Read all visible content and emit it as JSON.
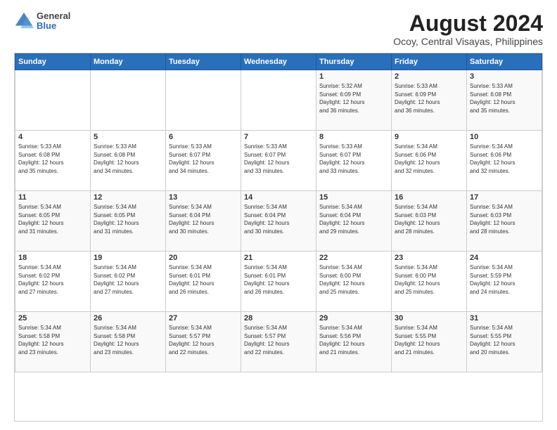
{
  "header": {
    "logo_line1": "General",
    "logo_line2": "Blue",
    "title": "August 2024",
    "subtitle": "Ocoy, Central Visayas, Philippines"
  },
  "weekdays": [
    "Sunday",
    "Monday",
    "Tuesday",
    "Wednesday",
    "Thursday",
    "Friday",
    "Saturday"
  ],
  "weeks": [
    [
      {
        "day": "",
        "info": ""
      },
      {
        "day": "",
        "info": ""
      },
      {
        "day": "",
        "info": ""
      },
      {
        "day": "",
        "info": ""
      },
      {
        "day": "1",
        "info": "Sunrise: 5:32 AM\nSunset: 6:09 PM\nDaylight: 12 hours\nand 36 minutes."
      },
      {
        "day": "2",
        "info": "Sunrise: 5:33 AM\nSunset: 6:09 PM\nDaylight: 12 hours\nand 36 minutes."
      },
      {
        "day": "3",
        "info": "Sunrise: 5:33 AM\nSunset: 6:08 PM\nDaylight: 12 hours\nand 35 minutes."
      }
    ],
    [
      {
        "day": "4",
        "info": "Sunrise: 5:33 AM\nSunset: 6:08 PM\nDaylight: 12 hours\nand 35 minutes."
      },
      {
        "day": "5",
        "info": "Sunrise: 5:33 AM\nSunset: 6:08 PM\nDaylight: 12 hours\nand 34 minutes."
      },
      {
        "day": "6",
        "info": "Sunrise: 5:33 AM\nSunset: 6:07 PM\nDaylight: 12 hours\nand 34 minutes."
      },
      {
        "day": "7",
        "info": "Sunrise: 5:33 AM\nSunset: 6:07 PM\nDaylight: 12 hours\nand 33 minutes."
      },
      {
        "day": "8",
        "info": "Sunrise: 5:33 AM\nSunset: 6:07 PM\nDaylight: 12 hours\nand 33 minutes."
      },
      {
        "day": "9",
        "info": "Sunrise: 5:34 AM\nSunset: 6:06 PM\nDaylight: 12 hours\nand 32 minutes."
      },
      {
        "day": "10",
        "info": "Sunrise: 5:34 AM\nSunset: 6:06 PM\nDaylight: 12 hours\nand 32 minutes."
      }
    ],
    [
      {
        "day": "11",
        "info": "Sunrise: 5:34 AM\nSunset: 6:05 PM\nDaylight: 12 hours\nand 31 minutes."
      },
      {
        "day": "12",
        "info": "Sunrise: 5:34 AM\nSunset: 6:05 PM\nDaylight: 12 hours\nand 31 minutes."
      },
      {
        "day": "13",
        "info": "Sunrise: 5:34 AM\nSunset: 6:04 PM\nDaylight: 12 hours\nand 30 minutes."
      },
      {
        "day": "14",
        "info": "Sunrise: 5:34 AM\nSunset: 6:04 PM\nDaylight: 12 hours\nand 30 minutes."
      },
      {
        "day": "15",
        "info": "Sunrise: 5:34 AM\nSunset: 6:04 PM\nDaylight: 12 hours\nand 29 minutes."
      },
      {
        "day": "16",
        "info": "Sunrise: 5:34 AM\nSunset: 6:03 PM\nDaylight: 12 hours\nand 28 minutes."
      },
      {
        "day": "17",
        "info": "Sunrise: 5:34 AM\nSunset: 6:03 PM\nDaylight: 12 hours\nand 28 minutes."
      }
    ],
    [
      {
        "day": "18",
        "info": "Sunrise: 5:34 AM\nSunset: 6:02 PM\nDaylight: 12 hours\nand 27 minutes."
      },
      {
        "day": "19",
        "info": "Sunrise: 5:34 AM\nSunset: 6:02 PM\nDaylight: 12 hours\nand 27 minutes."
      },
      {
        "day": "20",
        "info": "Sunrise: 5:34 AM\nSunset: 6:01 PM\nDaylight: 12 hours\nand 26 minutes."
      },
      {
        "day": "21",
        "info": "Sunrise: 5:34 AM\nSunset: 6:01 PM\nDaylight: 12 hours\nand 26 minutes."
      },
      {
        "day": "22",
        "info": "Sunrise: 5:34 AM\nSunset: 6:00 PM\nDaylight: 12 hours\nand 25 minutes."
      },
      {
        "day": "23",
        "info": "Sunrise: 5:34 AM\nSunset: 6:00 PM\nDaylight: 12 hours\nand 25 minutes."
      },
      {
        "day": "24",
        "info": "Sunrise: 5:34 AM\nSunset: 5:59 PM\nDaylight: 12 hours\nand 24 minutes."
      }
    ],
    [
      {
        "day": "25",
        "info": "Sunrise: 5:34 AM\nSunset: 5:58 PM\nDaylight: 12 hours\nand 23 minutes."
      },
      {
        "day": "26",
        "info": "Sunrise: 5:34 AM\nSunset: 5:58 PM\nDaylight: 12 hours\nand 23 minutes."
      },
      {
        "day": "27",
        "info": "Sunrise: 5:34 AM\nSunset: 5:57 PM\nDaylight: 12 hours\nand 22 minutes."
      },
      {
        "day": "28",
        "info": "Sunrise: 5:34 AM\nSunset: 5:57 PM\nDaylight: 12 hours\nand 22 minutes."
      },
      {
        "day": "29",
        "info": "Sunrise: 5:34 AM\nSunset: 5:56 PM\nDaylight: 12 hours\nand 21 minutes."
      },
      {
        "day": "30",
        "info": "Sunrise: 5:34 AM\nSunset: 5:55 PM\nDaylight: 12 hours\nand 21 minutes."
      },
      {
        "day": "31",
        "info": "Sunrise: 5:34 AM\nSunset: 5:55 PM\nDaylight: 12 hours\nand 20 minutes."
      }
    ]
  ]
}
